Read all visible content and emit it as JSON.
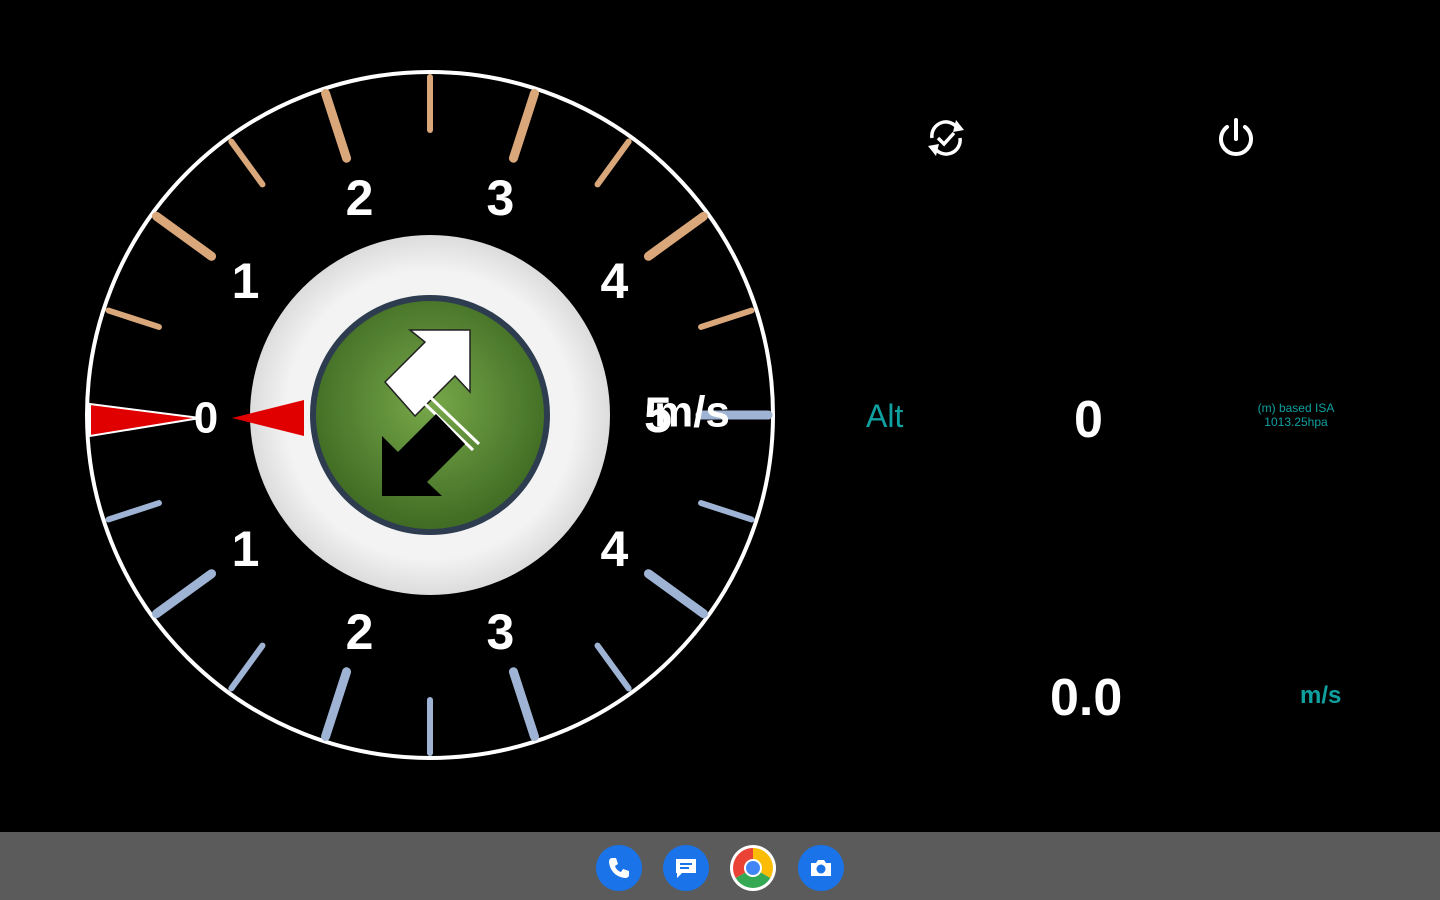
{
  "gauge": {
    "unit_label": "m/s",
    "up_numbers": [
      "1",
      "2",
      "3",
      "4",
      "5"
    ],
    "down_numbers": [
      "1",
      "2",
      "3",
      "4",
      "5"
    ],
    "zero_label": "0",
    "reading": 0.0,
    "colors": {
      "bezel": "#ffffff",
      "up_ticks": "#d9a77a",
      "down_ticks": "#9fb4d4",
      "needle": "#e00000",
      "hub": "#f0f0f0",
      "center": "#5f8f36"
    },
    "center_icon": "up-down-arrows-icon"
  },
  "toolbar": {
    "sync_icon": "sync-check-icon",
    "power_icon": "power-icon"
  },
  "altitude": {
    "label": "Alt",
    "value": "0",
    "note_line1": "(m) based ISA",
    "note_line2": "1013.25hpa"
  },
  "vario": {
    "value": "0.0",
    "unit": "m/s"
  },
  "taskbar": {
    "apps": [
      {
        "name": "phone-icon",
        "color": "#1a73e8"
      },
      {
        "name": "messages-icon",
        "color": "#1a73e8"
      },
      {
        "name": "chrome-icon",
        "color": "#ffffff"
      },
      {
        "name": "camera-icon",
        "color": "#1a73e8"
      }
    ]
  }
}
